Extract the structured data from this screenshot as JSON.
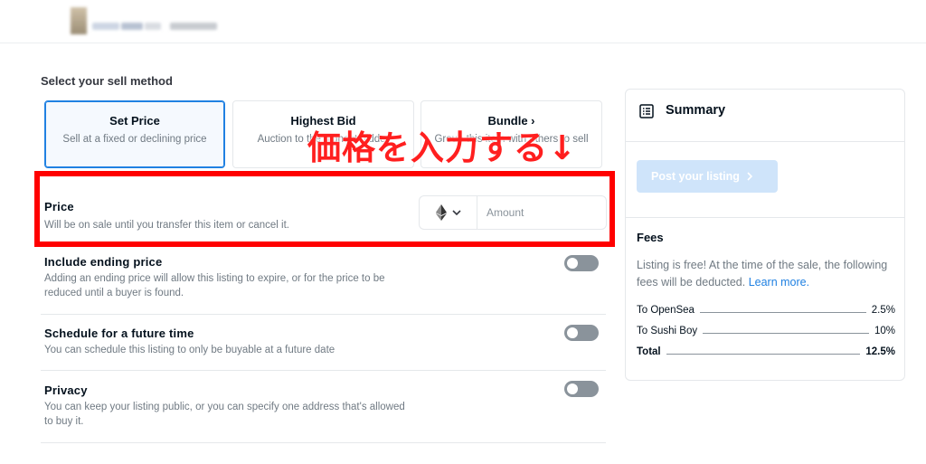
{
  "sell_method": {
    "title": "Select your sell method",
    "options": [
      {
        "title": "Set Price",
        "subtitle": "Sell at a fixed or declining price"
      },
      {
        "title": "Highest Bid",
        "subtitle": "Auction to the highest bidder"
      },
      {
        "title": "Bundle ›",
        "subtitle": "Group this item with others to sell"
      }
    ]
  },
  "annotation": "価格を入力する↓",
  "price": {
    "title": "Price",
    "subtitle": "Will be on sale until you transfer this item or cancel it.",
    "amount_placeholder": "Amount",
    "token_icon": "ethereum-icon"
  },
  "options": [
    {
      "title": "Include ending price",
      "subtitle": "Adding an ending price will allow this listing to expire, or for the price to be reduced until a buyer is found.",
      "enabled": false
    },
    {
      "title": "Schedule for a future time",
      "subtitle": "You can schedule this listing to only be buyable at a future date",
      "enabled": false
    },
    {
      "title": "Privacy",
      "subtitle": "You can keep your listing public, or you can specify one address that's allowed to buy it.",
      "enabled": false
    }
  ],
  "summary": {
    "title": "Summary",
    "post_button": "Post your listing",
    "fees_title": "Fees",
    "fees_description": "Listing is free! At the time of the sale, the following fees will be deducted.",
    "learn_more": "Learn more.",
    "fees": [
      {
        "label": "To OpenSea",
        "value": "2.5%"
      },
      {
        "label": "To Sushi Boy",
        "value": "10%"
      },
      {
        "label": "Total",
        "value": "12.5%"
      }
    ]
  },
  "colors": {
    "accent": "#2081e2",
    "annotation_red": "#ff0000",
    "disabled_button": "#cfe4fa"
  }
}
